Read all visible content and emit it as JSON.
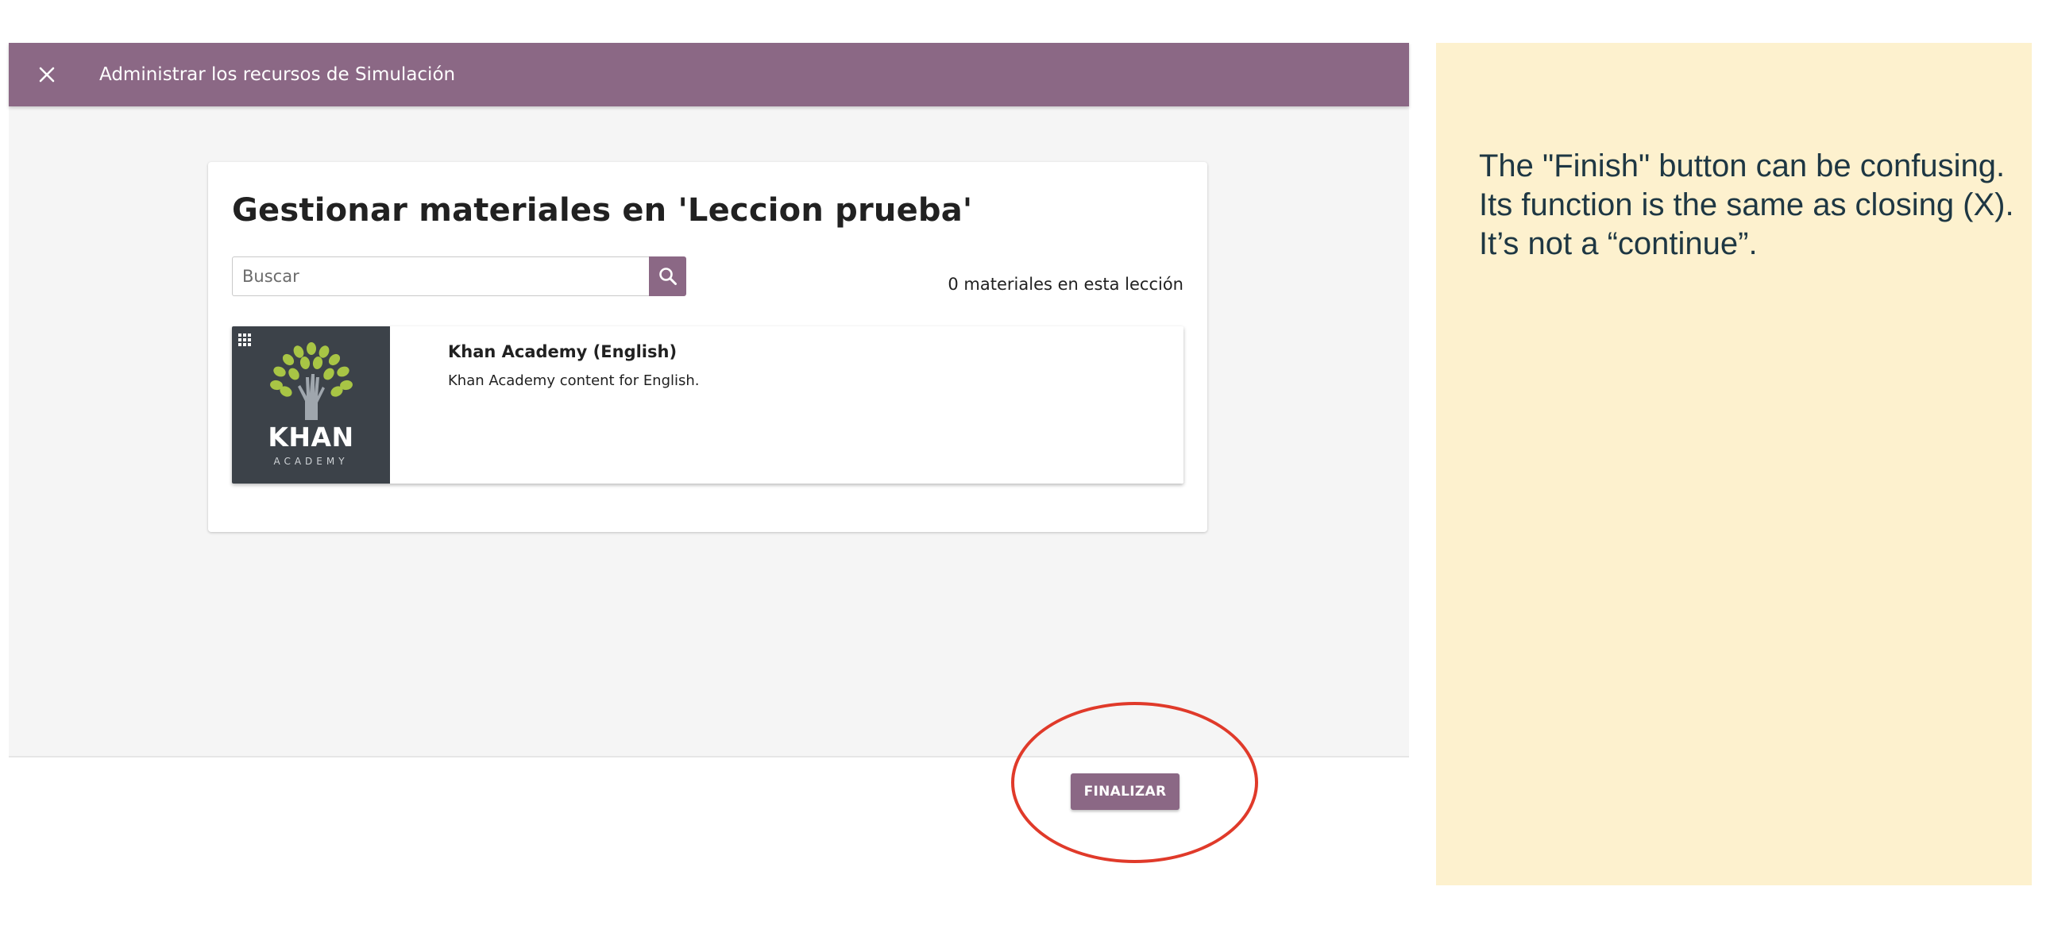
{
  "dialog": {
    "title": "Administrar los recursos de Simulación",
    "close_icon": "close-icon"
  },
  "main": {
    "heading": "Gestionar materiales en 'Leccion prueba'",
    "search": {
      "placeholder": "Buscar",
      "value": "",
      "icon": "search-icon"
    },
    "materials_count": "0 materiales en esta lección",
    "channels": [
      {
        "title": "Khan Academy (English)",
        "description": "Khan Academy content for English.",
        "logo_text": "KHAN",
        "logo_subtext": "ACADEMY",
        "badge_icon": "grid-icon"
      }
    ]
  },
  "footer": {
    "finish_label": "FINALIZAR"
  },
  "annotation": {
    "note": "The \"Finish\" button can be confusing. Its function is the same as closing (X). It’s not a “continue”."
  },
  "colors": {
    "brand": "#8b6885",
    "highlight_ring": "#e03a2a",
    "note_background": "#fdf1ce",
    "note_text": "#1e3743"
  }
}
